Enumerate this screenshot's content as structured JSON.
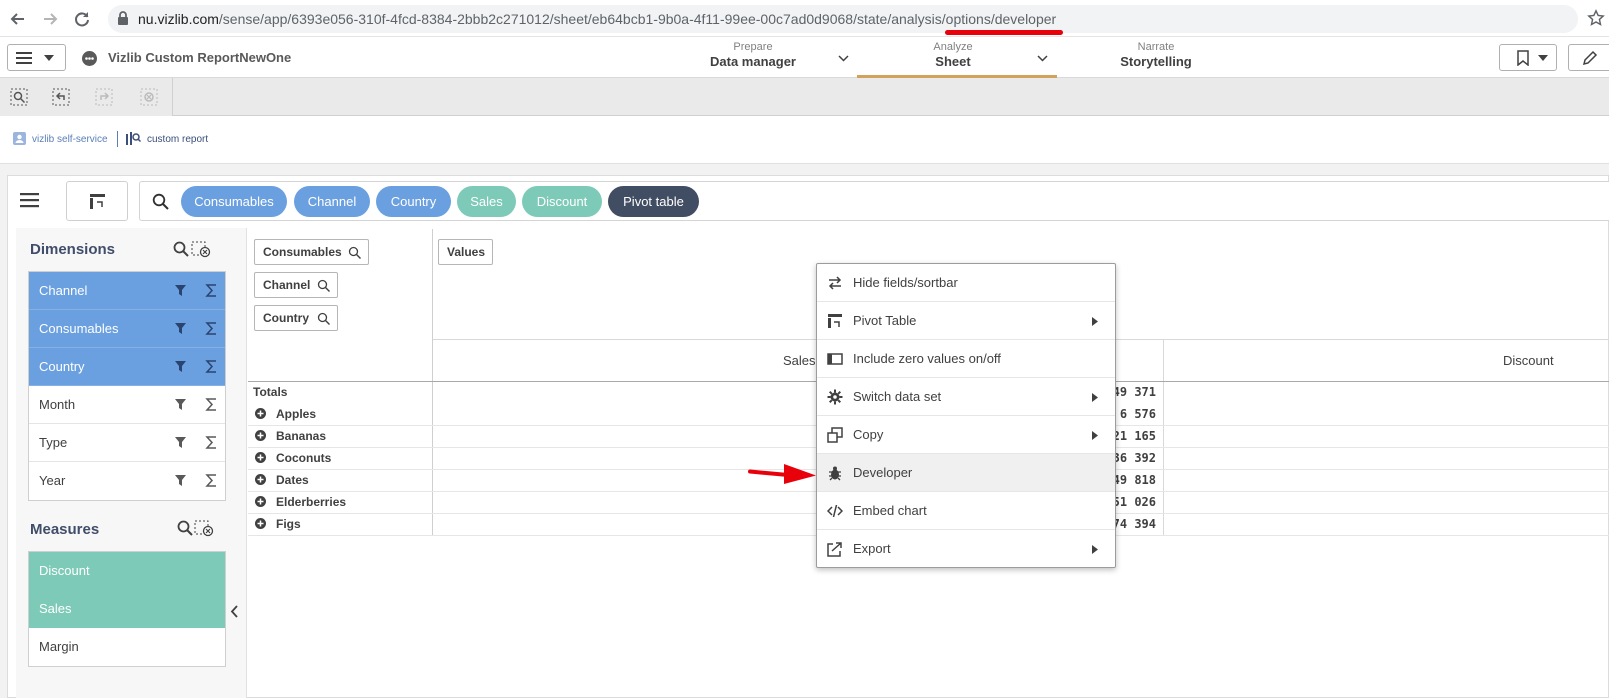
{
  "browser": {
    "url_host": "nu.vizlib.com",
    "url_path": "/sense/app/6393e056-310f-4fcd-8384-2bbb2c271012/sheet/eb64bcb1-9b0a-4f11-99ee-00c7ad0d9068/state/analysis/options/developer"
  },
  "header": {
    "app_title": "Vizlib Custom ReportNewOne",
    "nav": [
      {
        "small": "Prepare",
        "big": "Data manager"
      },
      {
        "small": "Analyze",
        "big": "Sheet"
      },
      {
        "small": "Narrate",
        "big": "Storytelling"
      }
    ],
    "accent_color": "#d2a25c"
  },
  "logos": {
    "left": "vizlib self-service",
    "right": "custom report"
  },
  "pills": [
    {
      "label": "Consumables",
      "kind": "dimension",
      "color": "#6a9fe0"
    },
    {
      "label": "Channel",
      "kind": "dimension",
      "color": "#6a9fe0"
    },
    {
      "label": "Country",
      "kind": "dimension",
      "color": "#6a9fe0"
    },
    {
      "label": "Sales",
      "kind": "measure",
      "color": "#7ecab8"
    },
    {
      "label": "Discount",
      "kind": "measure",
      "color": "#7ecab8"
    },
    {
      "label": "Pivot table",
      "kind": "chart",
      "color": "#414d63"
    }
  ],
  "dimensions_panel": {
    "title": "Dimensions",
    "items": [
      {
        "label": "Channel",
        "selected": true
      },
      {
        "label": "Consumables",
        "selected": true
      },
      {
        "label": "Country",
        "selected": true
      },
      {
        "label": "Month",
        "selected": false
      },
      {
        "label": "Type",
        "selected": false
      },
      {
        "label": "Year",
        "selected": false
      }
    ]
  },
  "measures_panel": {
    "title": "Measures",
    "items": [
      {
        "label": "Discount",
        "selected": true
      },
      {
        "label": "Sales",
        "selected": true
      },
      {
        "label": "Margin",
        "selected": false
      }
    ]
  },
  "pivot": {
    "row_dims": [
      "Consumables",
      "Channel",
      "Country"
    ],
    "values_label": "Values",
    "columns": [
      "Sales",
      "Discount"
    ],
    "totals_label": "Totals",
    "totals_value": "49 371",
    "rows": [
      {
        "label": "Apples",
        "value": "6 576"
      },
      {
        "label": "Bananas",
        "value": "21 165"
      },
      {
        "label": "Coconuts",
        "value": "36 392"
      },
      {
        "label": "Dates",
        "value": "49 818"
      },
      {
        "label": "Elderberries",
        "value": "51 026"
      },
      {
        "label": "Figs",
        "value": "74 394"
      }
    ]
  },
  "context_menu": {
    "items": [
      {
        "label": "Hide fields/sortbar",
        "icon": "swap-arrows-icon",
        "submenu": false
      },
      {
        "label": "Pivot Table",
        "icon": "pivot-table-icon",
        "submenu": true
      },
      {
        "label": "Include zero values on/off",
        "icon": "panel-toggle-icon",
        "submenu": false
      },
      {
        "label": "Switch data set",
        "icon": "gear-icon",
        "submenu": true
      },
      {
        "label": "Copy",
        "icon": "copy-icon",
        "submenu": true
      },
      {
        "label": "Developer",
        "icon": "bug-icon",
        "submenu": false
      },
      {
        "label": "Embed chart",
        "icon": "code-icon",
        "submenu": false
      },
      {
        "label": "Export",
        "icon": "export-icon",
        "submenu": true
      }
    ]
  }
}
